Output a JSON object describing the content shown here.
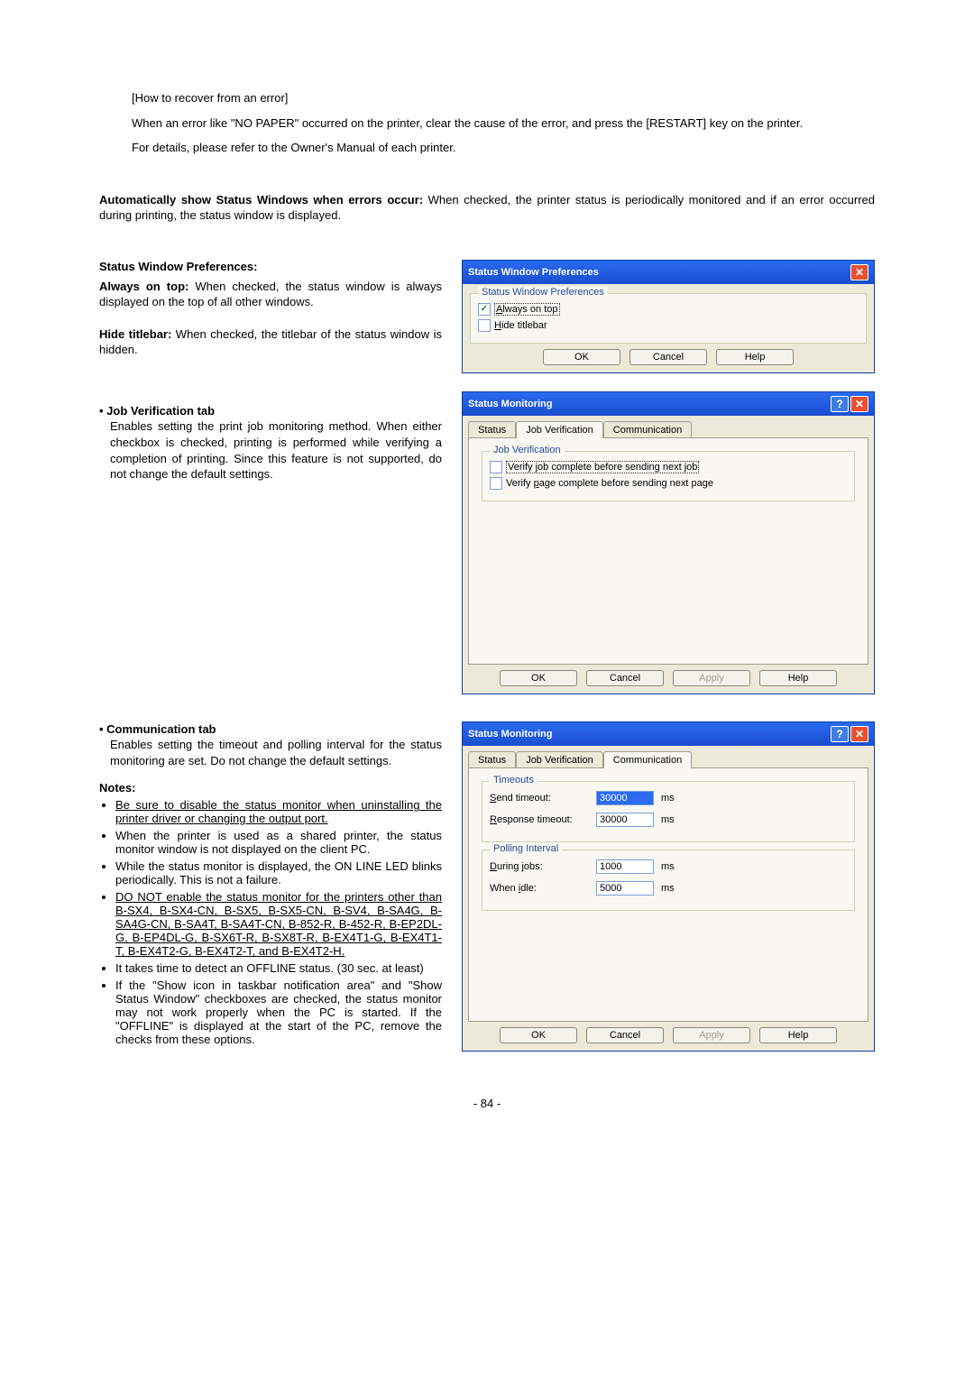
{
  "recover": {
    "title": "[How to recover from an error]",
    "l1": "When an error like \"NO PAPER\" occurred on the printer, clear the cause of the error, and press the [RESTART] key on the printer.",
    "l2": "For details, please refer to the Owner's Manual of each printer."
  },
  "autoshow": {
    "bold": "Automatically show Status Windows when errors occur:",
    "rest": "  When checked, the printer status is periodically monitored and if an error occurred during printing, the status window is displayed."
  },
  "swp": {
    "heading": "Status Window Preferences:",
    "aot_bold": "Always on top:",
    "aot_rest": "    When checked, the status window is always displayed on the top of all other windows.",
    "ht_bold": "Hide titlebar:",
    "ht_rest": "    When checked, the titlebar of the status window is hidden."
  },
  "jobv": {
    "head": "• Job Verification tab",
    "body": "Enables setting the print job monitoring method. When either checkbox is checked, printing is performed while verifying a completion of printing. Since this feature is not supported, do not change the default settings."
  },
  "comm": {
    "head": "• Communication tab",
    "body": "Enables setting the timeout and polling interval for the status monitoring are set.  Do not change the default settings."
  },
  "notes": {
    "title": "Notes:",
    "n1": "Be sure to disable the status monitor when uninstalling the printer driver or changing the output port.",
    "n2": "When the printer is used as a shared printer, the status monitor window is not displayed on the client PC.",
    "n3": "While the status monitor is displayed, the ON LINE LED blinks periodically.   This is not a failure.",
    "n4": "DO NOT enable the status monitor for the printers other than B-SX4, B-SX4-CN, B-SX5, B-SX5-CN, B-SV4, B-SA4G, B-SA4G-CN, B-SA4T, B-SA4T-CN, B-852-R, B-452-R, B-EP2DL-G, B-EP4DL-G, B-SX6T-R, B-SX8T-R, B-EX4T1-G, B-EX4T1-T, B-EX4T2-G, B-EX4T2-T, and B-EX4T2-H.",
    "n5": "It takes time to detect an OFFLINE status.   (30 sec. at least)",
    "n6": "If the \"Show icon in taskbar notification area\" and \"Show Status Window\" checkboxes are checked, the status monitor may not work properly when the PC is started.  If the \"OFFLINE\" is displayed at the start of the PC, remove the checks from these options."
  },
  "pagenum": "- 84 -",
  "dlg_swp": {
    "title": "Status Window Preferences",
    "group": "Status Window Preferences",
    "aot_pre": "A",
    "aot_rest": "lways on top",
    "ht_pre": "H",
    "ht_rest": "ide titlebar",
    "ok": "OK",
    "cancel": "Cancel",
    "help": "Help"
  },
  "dlg_jv": {
    "title": "Status Monitoring",
    "tab_status": "Status",
    "tab_jv": "Job Verification",
    "tab_comm": "Communication",
    "group": "Job Verification",
    "opt1_pre": "V",
    "opt1_mid": "erify ",
    "opt1_u": "j",
    "opt1_rest": "ob complete before sending next job",
    "opt2_pre": "Verify ",
    "opt2_u": "p",
    "opt2_rest": "age complete before sending next page",
    "ok": "OK",
    "cancel": "Cancel",
    "apply": "Apply",
    "help": "Help"
  },
  "dlg_cm": {
    "title": "Status Monitoring",
    "tab_status": "Status",
    "tab_jv": "Job Verification",
    "tab_comm": "Communication",
    "timeouts": "Timeouts",
    "send_u": "S",
    "send_rest": "end timeout:",
    "resp_u": "R",
    "resp_rest": "esponse timeout:",
    "polling": "Polling Interval",
    "during_u": "D",
    "during_rest": "uring jobs:",
    "idle_pre": "When ",
    "idle_u": "i",
    "idle_rest": "dle:",
    "ms": "ms",
    "ok": "OK",
    "cancel": "Cancel",
    "apply": "Apply",
    "help": "Help"
  },
  "chart_data": {
    "type": "table",
    "title": "Status Monitoring — Communication tab values",
    "rows": [
      {
        "group": "Timeouts",
        "label": "Send timeout",
        "value": 30000,
        "unit": "ms"
      },
      {
        "group": "Timeouts",
        "label": "Response timeout",
        "value": 30000,
        "unit": "ms"
      },
      {
        "group": "Polling Interval",
        "label": "During jobs",
        "value": 1000,
        "unit": "ms"
      },
      {
        "group": "Polling Interval",
        "label": "When idle",
        "value": 5000,
        "unit": "ms"
      }
    ]
  }
}
